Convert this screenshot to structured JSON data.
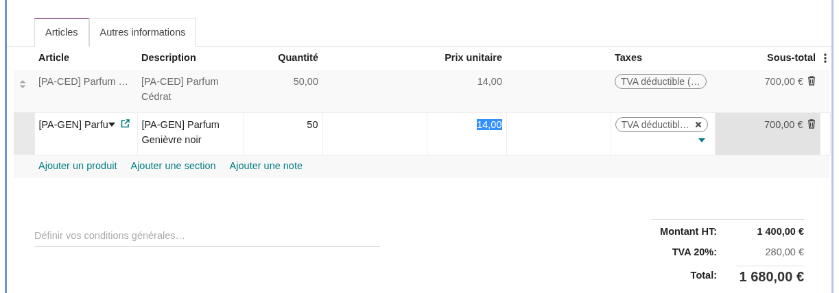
{
  "tabs": [
    {
      "label": "Articles",
      "selected": true
    },
    {
      "label": "Autres informations",
      "selected": false
    }
  ],
  "table": {
    "columns": [
      {
        "label": "Article"
      },
      {
        "label": "Description"
      },
      {
        "label": "Quantité"
      },
      {
        "label": "Prix unitaire"
      },
      {
        "label": "Taxes"
      },
      {
        "label": "Sous-total"
      }
    ],
    "rows": [
      {
        "editing": false,
        "article": "[PA-CED] Parfum …",
        "description": "[PA-CED] Parfum Cédrat",
        "quantity": "50,00",
        "unit_price": "14,00",
        "price_highlighted": false,
        "tax": "TVA déductible (…",
        "subtotal": "700,00 €"
      },
      {
        "editing": true,
        "article": "[PA-GEN] Parfu",
        "description": "[PA-GEN] Parfum Genièvre noir",
        "quantity": "50",
        "unit_price": "14,00",
        "price_highlighted": true,
        "tax": "TVA déductibl…",
        "subtotal": "700,00 €"
      }
    ],
    "add_links": [
      "Ajouter un produit",
      "Ajouter une section",
      "Ajouter une note"
    ]
  },
  "terms": {
    "placeholder": "Définir vos conditions générales…"
  },
  "totals": [
    {
      "kind": "untaxed",
      "label": "Montant HT:",
      "value": "1 400,00 €"
    },
    {
      "kind": "tax",
      "label": "TVA 20%:",
      "value": "280,00 €"
    },
    {
      "kind": "total",
      "label": "Total:",
      "value": "1 680,00 €"
    }
  ]
}
